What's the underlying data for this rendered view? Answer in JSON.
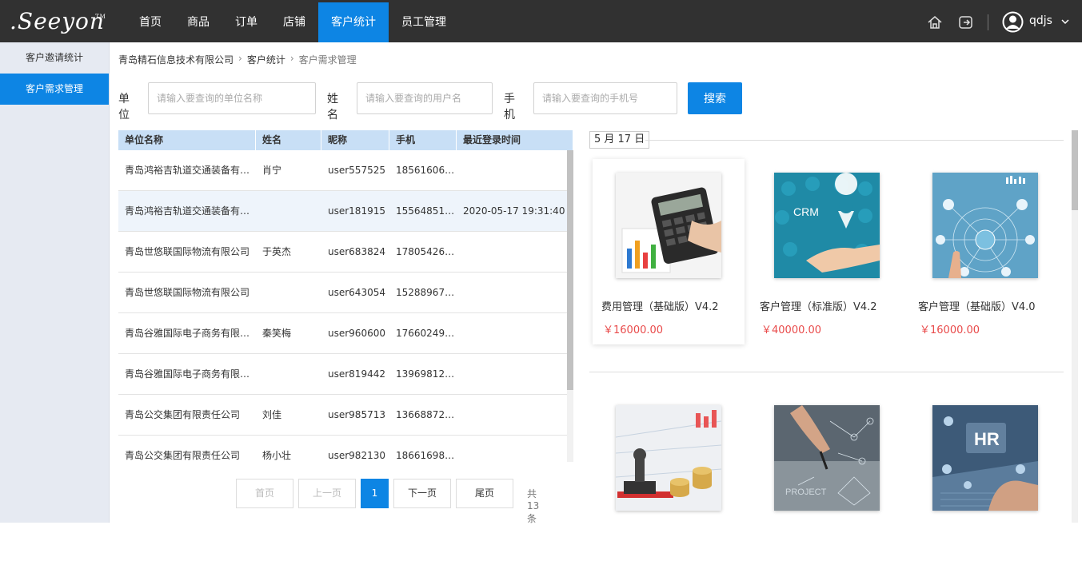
{
  "app": {
    "logo": ".Seeyon",
    "tm": "TM"
  },
  "nav": [
    "首页",
    "商品",
    "订单",
    "店铺",
    "客户统计",
    "员工管理"
  ],
  "user": {
    "name": "qdjs"
  },
  "sidebar": [
    "客户邀请统计",
    "客户需求管理"
  ],
  "breadcrumb": [
    "青岛精石信息技术有限公司",
    "客户统计",
    "客户需求管理"
  ],
  "search": {
    "unit_label": "单位",
    "unit_placeholder": "请输入要查询的单位名称",
    "name_label": "姓名",
    "name_placeholder": "请输入要查询的用户名",
    "phone_label": "手机",
    "phone_placeholder": "请输入要查询的手机号",
    "button": "搜索"
  },
  "table": {
    "headers": [
      "单位名称",
      "姓名",
      "昵称",
      "手机",
      "最近登录时间"
    ],
    "rows": [
      [
        "青岛鸿裕吉轨道交通装备有限公司",
        "肖宁",
        "user557525",
        "18561606xxx",
        ""
      ],
      [
        "青岛鸿裕吉轨道交通装备有限公司",
        "",
        "user181915",
        "15564851xxx",
        "2020-05-17 19:31:40"
      ],
      [
        "青岛世悠联国际物流有限公司",
        "于英杰",
        "user683824",
        "17805426xxx",
        ""
      ],
      [
        "青岛世悠联国际物流有限公司",
        "",
        "user643054",
        "15288967xxx",
        ""
      ],
      [
        "青岛谷雅国际电子商务有限公司",
        "秦笑梅",
        "user960600",
        "17660249xxx",
        ""
      ],
      [
        "青岛谷雅国际电子商务有限公司",
        "",
        "user819442",
        "13969812xxx",
        ""
      ],
      [
        "青岛公交集团有限责任公司",
        "刘佳",
        "user985713",
        "13668872xxx",
        ""
      ],
      [
        "青岛公交集团有限责任公司",
        "杨小壮",
        "user982130",
        "18661698xxx",
        ""
      ]
    ]
  },
  "pager": {
    "first": "首页",
    "prev": "上一页",
    "current": "1",
    "next": "下一页",
    "last": "尾页",
    "total": "共13条"
  },
  "date_label": "5 月 17 日",
  "products": [
    {
      "name": "费用管理（基础版）V4.2",
      "price": "￥16000.00",
      "icon": "calculator-image"
    },
    {
      "name": "客户管理（标准版）V4.2",
      "price": "￥40000.00",
      "icon": "crm-hand-image"
    },
    {
      "name": "客户管理（基础版）V4.0",
      "price": "￥16000.00",
      "icon": "crm-network-image"
    },
    {
      "name": "",
      "price": "",
      "icon": "stamp-coins-image"
    },
    {
      "name": "",
      "price": "",
      "icon": "project-hand-image"
    },
    {
      "name": "",
      "price": "",
      "icon": "hr-laptop-image"
    }
  ],
  "colors": {
    "nav_bg": "#313131",
    "accent": "#0d85e4",
    "price": "#e94b4b",
    "sidebar_bg": "#e6eaf2"
  }
}
